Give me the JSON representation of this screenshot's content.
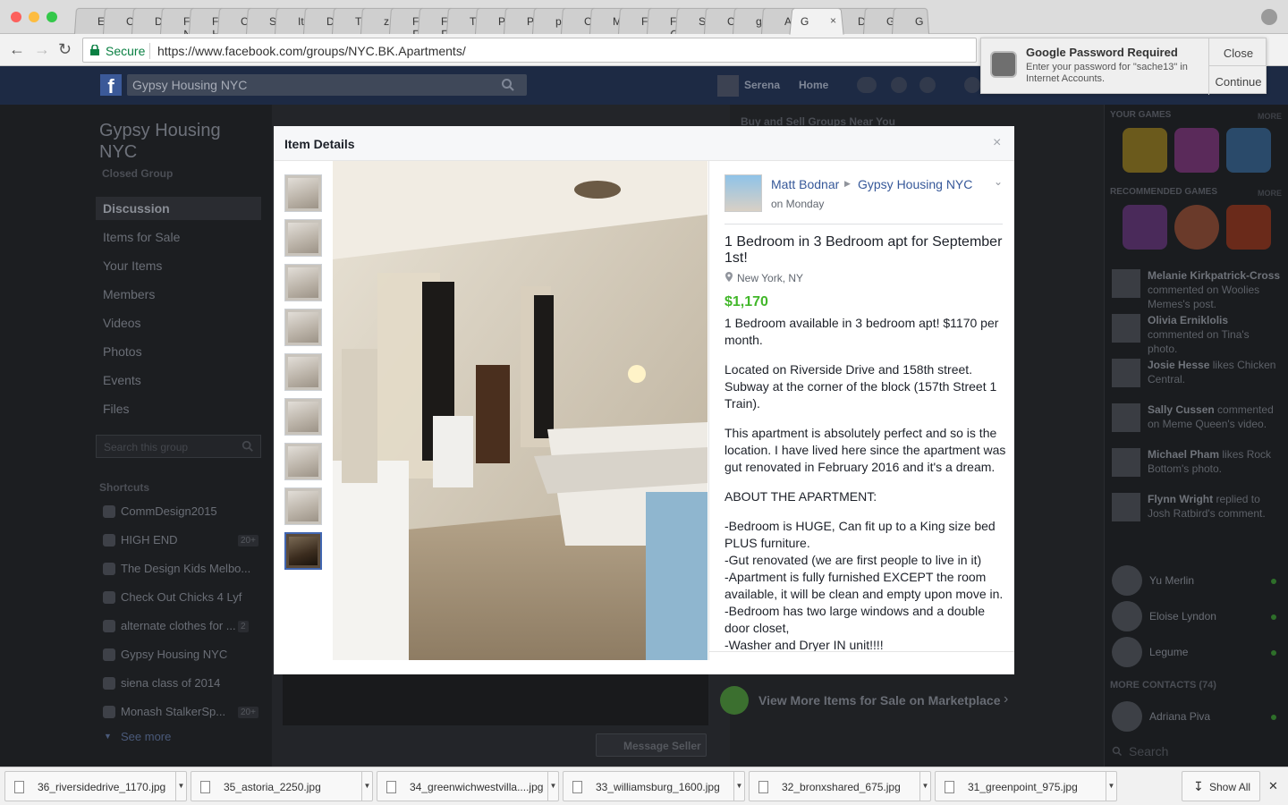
{
  "browser": {
    "tabs": [
      {
        "icon": "document-icon",
        "label": "E"
      },
      {
        "icon": "circle-icon",
        "label": "C"
      },
      {
        "icon": "zen-icon",
        "label": "D"
      },
      {
        "icon": "fc-icon",
        "label": "FC N"
      },
      {
        "icon": "f-icon",
        "label": "F H"
      },
      {
        "icon": "building-icon",
        "label": "C"
      },
      {
        "icon": "gear-icon",
        "label": "S"
      },
      {
        "icon": "target-icon",
        "label": "It"
      },
      {
        "icon": "de-icon",
        "label": "D"
      },
      {
        "icon": "t-icon",
        "label": "T"
      },
      {
        "icon": "dash-icon",
        "label": "z"
      },
      {
        "icon": "fj-icon",
        "label": "FJ F"
      },
      {
        "icon": "fj-icon",
        "label": "FJ F"
      },
      {
        "icon": "image-icon",
        "label": "T"
      },
      {
        "icon": "document-icon",
        "label": "P"
      },
      {
        "icon": "pinterest-icon",
        "label": "P"
      },
      {
        "icon": "phone-icon",
        "label": "p"
      },
      {
        "icon": "document-icon",
        "label": "C"
      },
      {
        "icon": "blue-icon",
        "label": "M"
      },
      {
        "icon": "document-icon",
        "label": "F"
      },
      {
        "icon": "f-icon",
        "label": "F C"
      },
      {
        "icon": "c-icon",
        "label": "S"
      },
      {
        "icon": "dot-icon",
        "label": "C"
      },
      {
        "icon": "google-icon",
        "label": "g"
      },
      {
        "icon": "a-icon",
        "label": "A"
      },
      {
        "icon": "g-icon",
        "label": "G",
        "active": true
      },
      {
        "icon": "document-icon",
        "label": "D"
      },
      {
        "icon": "facebook-icon",
        "label": "G"
      },
      {
        "icon": "facebook-icon",
        "label": "G"
      }
    ],
    "secure_label": "Secure",
    "url": "https://www.facebook.com/groups/NYC.BK.Apartments/"
  },
  "fb_header": {
    "logo": "f",
    "search_value": "Gypsy Housing NYC",
    "user_name": "Serena",
    "home_label": "Home"
  },
  "left_nav": {
    "group_title": "Gypsy Housing NYC",
    "group_privacy": "Closed Group",
    "items": [
      "Discussion",
      "Items for Sale",
      "Your Items",
      "Members",
      "Videos",
      "Photos",
      "Events",
      "Files"
    ],
    "search_placeholder": "Search this group",
    "shortcuts_heading": "Shortcuts",
    "shortcuts": [
      {
        "label": "CommDesign2015",
        "badge": ""
      },
      {
        "label": "HIGH END",
        "badge": "20+"
      },
      {
        "label": "The Design Kids Melbo...",
        "badge": ""
      },
      {
        "label": "Check Out Chicks 4 Lyf",
        "badge": ""
      },
      {
        "label": "alternate clothes for ...",
        "badge": "2"
      },
      {
        "label": "Gypsy Housing NYC",
        "badge": ""
      },
      {
        "label": "siena class of 2014",
        "badge": ""
      },
      {
        "label": "Monash StalkerSp...",
        "badge": "20+"
      }
    ],
    "see_more": "See more"
  },
  "background": {
    "buy_sell_heading": "Buy and Sell Groups Near You",
    "view_more": "View More Items for Sale on Marketplace",
    "message_seller": "Message Seller"
  },
  "right_sidebar": {
    "your_games": "YOUR GAMES",
    "recommended_games": "RECOMMENDED GAMES",
    "more": "MORE",
    "ticker": [
      {
        "name": "Melanie Kirkpatrick-Cross",
        "text": "commented on Woolies Memes's post."
      },
      {
        "name": "Olivia Erniklolis",
        "text": "commented on Tina's photo."
      },
      {
        "name": "Josie Hesse",
        "text": "likes Chicken Central."
      },
      {
        "name": "Sally Cussen",
        "text": "commented on Meme Queen's video."
      },
      {
        "name": "Michael Pham",
        "text": "likes Rock Bottom's photo."
      },
      {
        "name": "Flynn Wright",
        "text": "replied to Josh Ratbird's comment."
      }
    ],
    "contacts": [
      "Yu Merlin",
      "Eloise Lyndon",
      "Legume"
    ],
    "more_contacts": "MORE CONTACTS (74)",
    "more_contacts_list": [
      "Adriana Piva"
    ],
    "search_placeholder": "Search"
  },
  "modal": {
    "title": "Item Details",
    "thumb_count": 9,
    "author": "Matt Bodnar",
    "group": "Gypsy Housing NYC",
    "posted": "on Monday",
    "listing_title": "1 Bedroom in 3 Bedroom apt for September 1st!",
    "location": "New York, NY",
    "price": "$1,170",
    "paragraphs": [
      "1 Bedroom available in 3 bedroom apt! $1170 per month.",
      "Located on Riverside Drive and 158th street. Subway at the corner of the block (157th Street 1 Train).",
      "This apartment is absolutely perfect and so is the location. I have lived here since the apartment was gut renovated in February 2016 and it's a dream.",
      "ABOUT THE APARTMENT:"
    ],
    "bullets": [
      "-Bedroom is HUGE, Can fit up to a King size bed PLUS furniture.",
      "-Gut renovated (we are first people to live in it)",
      "-Apartment is fully furnished EXCEPT the room available, it will be clean and empty upon move in.",
      "-Bedroom has two large windows and a double door closet,",
      "-Washer and Dryer IN unit!!!!"
    ]
  },
  "password_popup": {
    "title": "Google Password Required",
    "body": "Enter your password for \"sache13\" in Internet Accounts.",
    "close": "Close",
    "continue": "Continue"
  },
  "downloads": {
    "files": [
      "36_riversidedrive_1170.jpg",
      "35_astoria_2250.jpg",
      "34_greenwichwestvilla....jpg",
      "33_williamsburg_1600.jpg",
      "32_bronxshared_675.jpg",
      "31_greenpoint_975.jpg"
    ],
    "show_all": "Show All"
  },
  "colors": {
    "fb_blue": "#3b5998",
    "link": "#365899",
    "price_green": "#42b72a",
    "secure_green": "#0b8043"
  }
}
